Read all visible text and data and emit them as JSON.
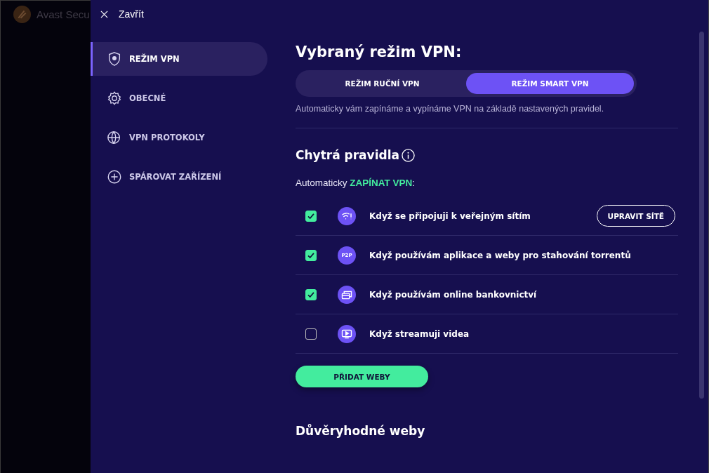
{
  "background_window": {
    "title": "Avast Secu"
  },
  "close": {
    "label": "Zavřít"
  },
  "sidebar": {
    "items": [
      {
        "label": "REŽIM VPN",
        "selected": true
      },
      {
        "label": "OBECNÉ",
        "selected": false
      },
      {
        "label": "VPN PROTOKOLY",
        "selected": false
      },
      {
        "label": "SPÁROVAT ZAŘÍZENÍ",
        "selected": false
      }
    ]
  },
  "mode": {
    "title": "Vybraný režim VPN:",
    "options": [
      {
        "label": "REŽIM RUČNÍ VPN",
        "selected": false
      },
      {
        "label": "REŽIM SMART VPN",
        "selected": true
      }
    ],
    "description": "Automaticky vám zapínáme a vypínáme VPN na základě nastavených pravidel."
  },
  "rules": {
    "title": "Chytrá pravidla",
    "subtitle": "Automaticky **ZAPÍNAT VPN**:",
    "items": [
      {
        "label": "Když se připojuji k veřejným sítím",
        "checked": true,
        "action": "UPRAVIT SÍTĚ"
      },
      {
        "label": "Když používám aplikace a weby pro stahování torrentů",
        "icon_text": "P2P",
        "checked": true
      },
      {
        "label": "Když používám online bankovnictví",
        "checked": true
      },
      {
        "label": "Když streamuji videa",
        "checked": false
      }
    ],
    "add_button": "PŘIDAT WEBY"
  },
  "trusted": {
    "title": "Důvěryhodné weby"
  }
}
